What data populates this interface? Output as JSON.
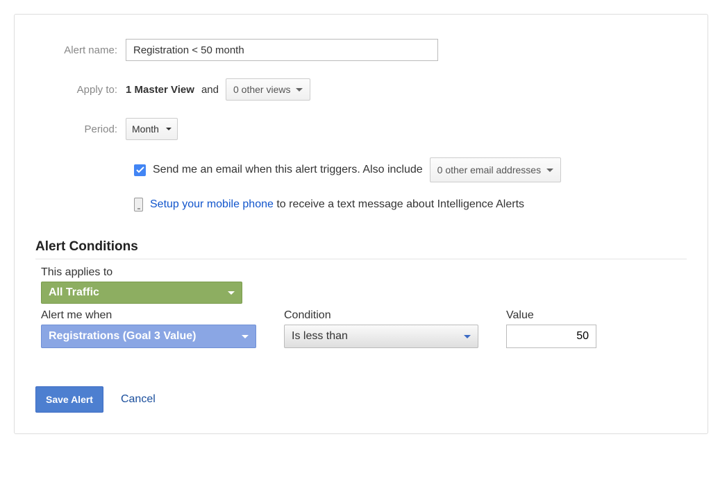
{
  "labels": {
    "alert_name": "Alert name:",
    "apply_to": "Apply to:",
    "period": "Period:"
  },
  "alert_name_value": "Registration < 50 month",
  "apply_to": {
    "view_name": "1 Master View",
    "and": " and ",
    "other_views": "0 other views"
  },
  "period_value": "Month",
  "email_checkbox": {
    "text": "Send me an email when this alert triggers. Also include ",
    "other_emails": "0 other email addresses"
  },
  "mobile": {
    "link_text": "Setup your mobile phone",
    "suffix": " to receive a text message about Intelligence Alerts"
  },
  "conditions": {
    "heading": "Alert Conditions",
    "applies_to_label": "This applies to",
    "applies_to_value": "All Traffic",
    "alert_me_label": "Alert me when",
    "alert_me_value": "Registrations (Goal 3 Value)",
    "condition_label": "Condition",
    "condition_value": "Is less than",
    "value_label": "Value",
    "value_value": "50"
  },
  "buttons": {
    "save": "Save Alert",
    "cancel": "Cancel"
  }
}
